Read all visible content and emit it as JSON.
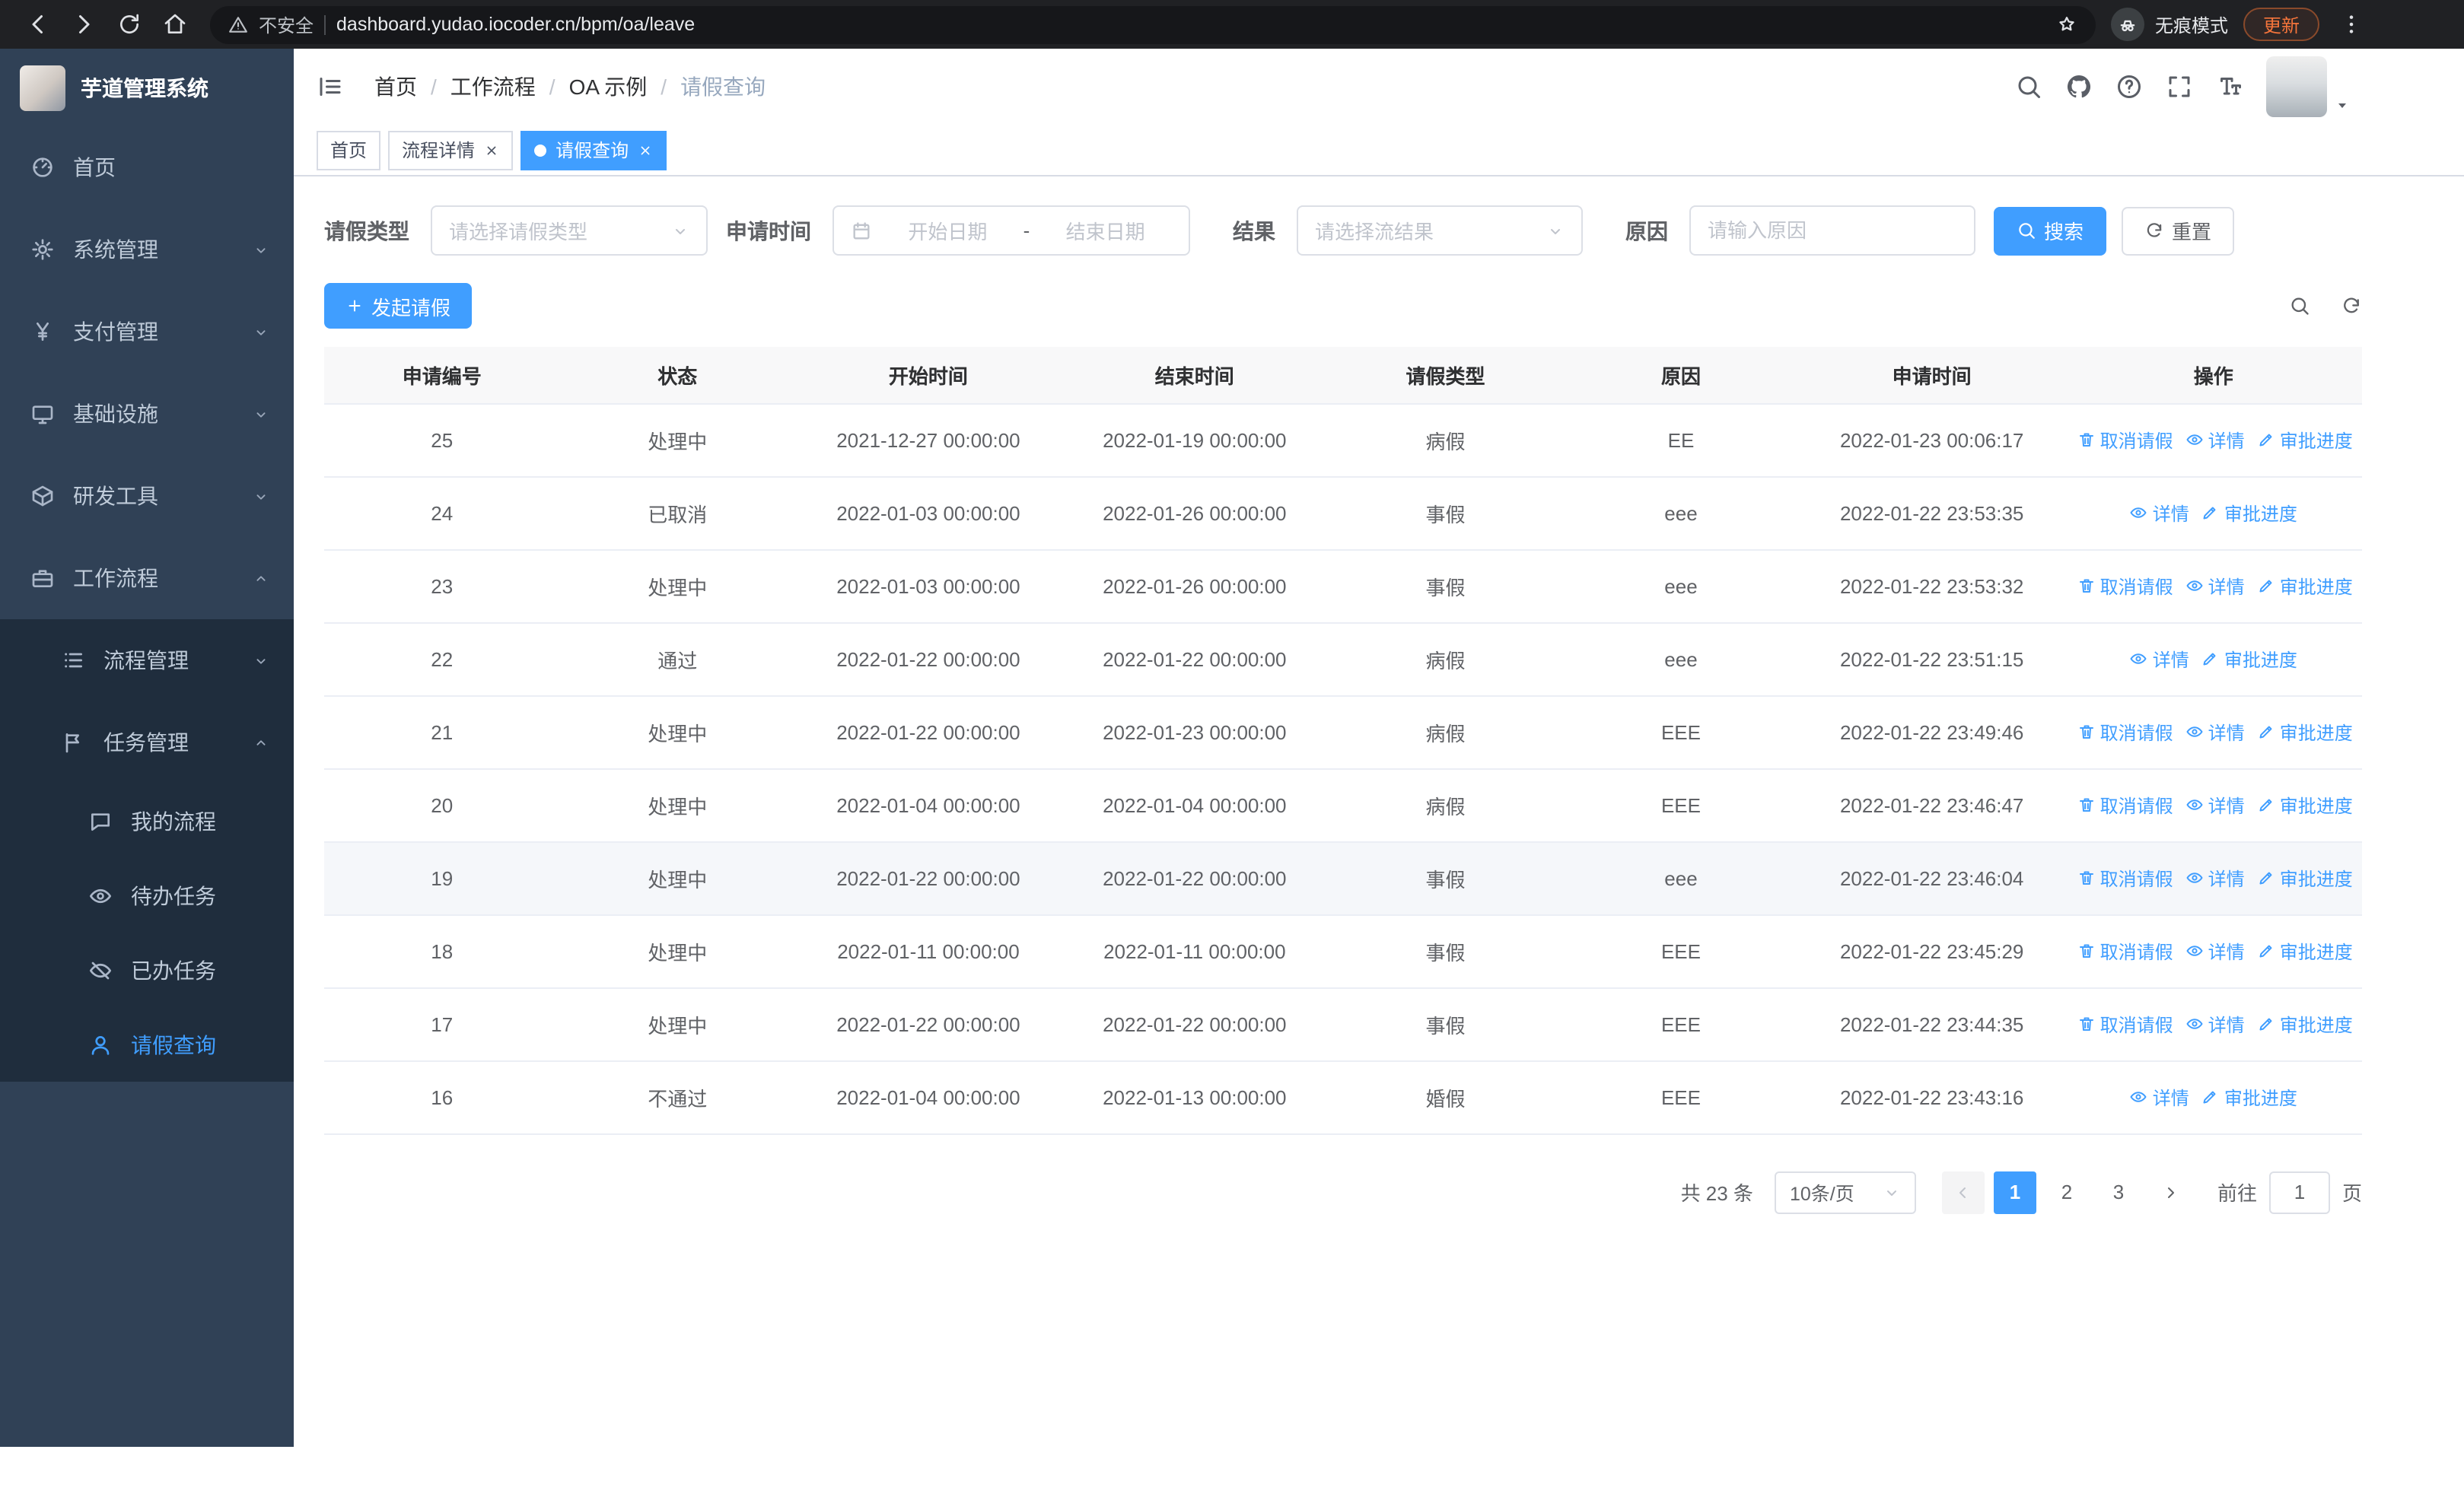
{
  "browser": {
    "security_label": "不安全",
    "url": "dashboard.yudao.iocoder.cn/bpm/oa/leave",
    "incognito_label": "无痕模式",
    "update_label": "更新"
  },
  "sidebar": {
    "logo_title": "芋道管理系统",
    "menu": [
      {
        "key": "home",
        "label": "首页",
        "icon": "gauge"
      },
      {
        "key": "system",
        "label": "系统管理",
        "icon": "gear",
        "arrow": "down"
      },
      {
        "key": "payment",
        "label": "支付管理",
        "icon": "yen",
        "arrow": "down"
      },
      {
        "key": "infrastructure",
        "label": "基础设施",
        "icon": "monitor",
        "arrow": "down"
      },
      {
        "key": "devtools",
        "label": "研发工具",
        "icon": "box",
        "arrow": "down"
      },
      {
        "key": "workflow",
        "label": "工作流程",
        "icon": "briefcase",
        "arrow": "up",
        "expanded": true,
        "children": [
          {
            "key": "process-mgmt",
            "label": "流程管理",
            "icon": "list",
            "arrow": "down"
          },
          {
            "key": "task-mgmt",
            "label": "任务管理",
            "icon": "flag",
            "arrow": "up",
            "expanded": true,
            "children": [
              {
                "key": "my-process",
                "label": "我的流程",
                "icon": "chat"
              },
              {
                "key": "todo-task",
                "label": "待办任务",
                "icon": "eye"
              },
              {
                "key": "done-task",
                "label": "已办任务",
                "icon": "eye-off"
              },
              {
                "key": "leave-query",
                "label": "请假查询",
                "icon": "user",
                "active": true
              }
            ]
          }
        ]
      }
    ]
  },
  "breadcrumb": [
    {
      "key": "home",
      "label": "首页"
    },
    {
      "key": "workflow",
      "label": "工作流程"
    },
    {
      "key": "oa-demo",
      "label": "OA 示例"
    },
    {
      "key": "leave-query",
      "label": "请假查询",
      "current": true
    }
  ],
  "tabs": [
    {
      "key": "home",
      "label": "首页"
    },
    {
      "key": "process-detail",
      "label": "流程详情",
      "closable": true
    },
    {
      "key": "leave-query",
      "label": "请假查询",
      "closable": true,
      "active": true
    }
  ],
  "filters": {
    "leave_type_label": "请假类型",
    "leave_type_placeholder": "请选择请假类型",
    "apply_time_label": "申请时间",
    "start_date_placeholder": "开始日期",
    "date_separator": "-",
    "end_date_placeholder": "结束日期",
    "result_label": "结果",
    "result_placeholder": "请选择流结果",
    "reason_label": "原因",
    "reason_placeholder": "请输入原因",
    "search_label": "搜索",
    "reset_label": "重置"
  },
  "toolbar": {
    "create_label": "发起请假"
  },
  "actions": {
    "cancel": {
      "label": "取消请假",
      "icon": "trash"
    },
    "detail": {
      "label": "详情",
      "icon": "eye"
    },
    "progress": {
      "label": "审批进度",
      "icon": "edit"
    }
  },
  "table": {
    "columns": [
      "申请编号",
      "状态",
      "开始时间",
      "结束时间",
      "请假类型",
      "原因",
      "申请时间",
      "操作"
    ],
    "rows": [
      {
        "id": "25",
        "status": "处理中",
        "start": "2021-12-27 00:00:00",
        "end": "2022-01-19 00:00:00",
        "type": "病假",
        "reason": "EE",
        "applied": "2022-01-23 00:06:17",
        "actions": [
          "cancel",
          "detail",
          "progress"
        ]
      },
      {
        "id": "24",
        "status": "已取消",
        "start": "2022-01-03 00:00:00",
        "end": "2022-01-26 00:00:00",
        "type": "事假",
        "reason": "eee",
        "applied": "2022-01-22 23:53:35",
        "actions": [
          "detail",
          "progress"
        ]
      },
      {
        "id": "23",
        "status": "处理中",
        "start": "2022-01-03 00:00:00",
        "end": "2022-01-26 00:00:00",
        "type": "事假",
        "reason": "eee",
        "applied": "2022-01-22 23:53:32",
        "actions": [
          "cancel",
          "detail",
          "progress"
        ]
      },
      {
        "id": "22",
        "status": "通过",
        "start": "2022-01-22 00:00:00",
        "end": "2022-01-22 00:00:00",
        "type": "病假",
        "reason": "eee",
        "applied": "2022-01-22 23:51:15",
        "actions": [
          "detail",
          "progress"
        ]
      },
      {
        "id": "21",
        "status": "处理中",
        "start": "2022-01-22 00:00:00",
        "end": "2022-01-23 00:00:00",
        "type": "病假",
        "reason": "EEE",
        "applied": "2022-01-22 23:49:46",
        "actions": [
          "cancel",
          "detail",
          "progress"
        ]
      },
      {
        "id": "20",
        "status": "处理中",
        "start": "2022-01-04 00:00:00",
        "end": "2022-01-04 00:00:00",
        "type": "病假",
        "reason": "EEE",
        "applied": "2022-01-22 23:46:47",
        "actions": [
          "cancel",
          "detail",
          "progress"
        ]
      },
      {
        "id": "19",
        "status": "处理中",
        "start": "2022-01-22 00:00:00",
        "end": "2022-01-22 00:00:00",
        "type": "事假",
        "reason": "eee",
        "applied": "2022-01-22 23:46:04",
        "actions": [
          "cancel",
          "detail",
          "progress"
        ],
        "highlight": true
      },
      {
        "id": "18",
        "status": "处理中",
        "start": "2022-01-11 00:00:00",
        "end": "2022-01-11 00:00:00",
        "type": "事假",
        "reason": "EEE",
        "applied": "2022-01-22 23:45:29",
        "actions": [
          "cancel",
          "detail",
          "progress"
        ]
      },
      {
        "id": "17",
        "status": "处理中",
        "start": "2022-01-22 00:00:00",
        "end": "2022-01-22 00:00:00",
        "type": "事假",
        "reason": "EEE",
        "applied": "2022-01-22 23:44:35",
        "actions": [
          "cancel",
          "detail",
          "progress"
        ]
      },
      {
        "id": "16",
        "status": "不通过",
        "start": "2022-01-04 00:00:00",
        "end": "2022-01-13 00:00:00",
        "type": "婚假",
        "reason": "EEE",
        "applied": "2022-01-22 23:43:16",
        "actions": [
          "detail",
          "progress"
        ]
      }
    ]
  },
  "pagination": {
    "total_text": "共 23 条",
    "page_size_text": "10条/页",
    "pages": [
      "1",
      "2",
      "3"
    ],
    "active_page": "1",
    "goto_label": "前往",
    "goto_value": "1",
    "page_unit": "页"
  },
  "colors": {
    "primary": "#409eff",
    "sidebar_bg": "#304156",
    "submenu_bg": "#1f2d3d",
    "header_bg": "#f8f8f9"
  }
}
